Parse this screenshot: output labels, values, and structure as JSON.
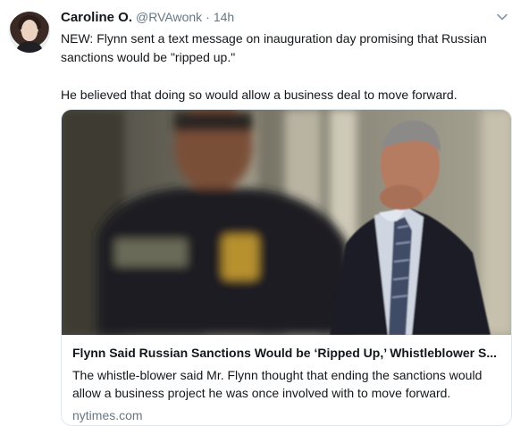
{
  "tweet": {
    "author_name": "Caroline O.",
    "handle": "@RVAwonk",
    "separator": "·",
    "time": "14h",
    "text_line_1": "NEW: Flynn sent a text message on inauguration day promising that Russian sanctions would be \"ripped up.\"",
    "text_line_2": "He believed that doing so would allow a business deal to move forward."
  },
  "card": {
    "title": "Flynn Said Russian Sanctions Would be ‘Ripped Up,’ Whistleblower S...",
    "description": "The whistle-blower said Mr. Flynn thought that ending the sanctions would allow a business project he was once involved with to move forward.",
    "domain": "nytimes.com",
    "badge_text": "POLICE DHS"
  },
  "icons": {
    "avatar": "profile-photo",
    "caret": "chevron-down-icon"
  },
  "colors": {
    "text": "#14171a",
    "secondary": "#657786",
    "border": "#e1e8ed"
  }
}
